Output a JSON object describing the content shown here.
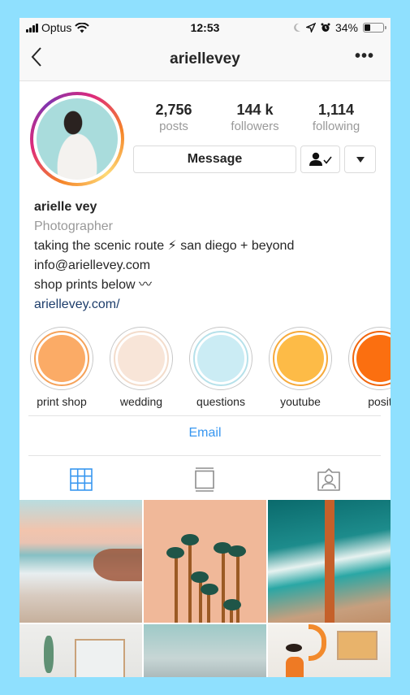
{
  "status_bar": {
    "carrier": "Optus",
    "time": "12:53",
    "battery_percent_label": "34%",
    "battery_level": 0.34,
    "icons": [
      "signal-icon",
      "wifi-icon",
      "moon-icon",
      "location-icon",
      "alarm-icon",
      "battery-icon"
    ]
  },
  "nav": {
    "title": "ariellevey",
    "back_icon": "chevron-left-icon",
    "more_label": "•••"
  },
  "profile": {
    "stats": [
      {
        "value": "2,756",
        "label": "posts"
      },
      {
        "value": "144 k",
        "label": "followers"
      },
      {
        "value": "1,114",
        "label": "following"
      }
    ],
    "buttons": {
      "message": "Message",
      "following_icon": "person-check-icon",
      "dropdown_icon": "caret-down-icon"
    },
    "colors": {
      "story_ring_start": "#f58529",
      "story_ring_end": "#8134af"
    }
  },
  "bio": {
    "name": "arielle vey",
    "category": "Photographer",
    "lines": [
      "taking the scenic route ⚡ san diego + beyond",
      "info@ariellevey.com",
      "shop prints below 〰"
    ],
    "link": "ariellevey.com/"
  },
  "highlights": [
    {
      "label": "print shop",
      "color": "#fbab66",
      "ring": "#f5a25a"
    },
    {
      "label": "wedding",
      "color": "#f8e5d8",
      "ring": "#f3dccb"
    },
    {
      "label": "questions",
      "color": "#cbecf4",
      "ring": "#b6e1ea"
    },
    {
      "label": "youtube",
      "color": "#fdbb47",
      "ring": "#f6a93a"
    },
    {
      "label": "posit",
      "color": "#fb6f10",
      "ring": "#f0650c"
    }
  ],
  "contact": {
    "email_label": "Email"
  },
  "tabs": [
    {
      "name": "grid",
      "icon": "grid-icon",
      "active": true
    },
    {
      "name": "feed",
      "icon": "feed-icon",
      "active": false
    },
    {
      "name": "tagged",
      "icon": "tagged-icon",
      "active": false
    }
  ],
  "accent_color": "#3897f0",
  "posts": [
    {
      "description": "beach waves and rocks at sunset"
    },
    {
      "description": "palm trees against peach sky"
    },
    {
      "description": "aerial view of pier over teal ocean"
    },
    {
      "description": "white wall with framed car print and plant"
    },
    {
      "description": "cloudy teal sky"
    },
    {
      "description": "woman in orange sweater with wall art"
    }
  ]
}
